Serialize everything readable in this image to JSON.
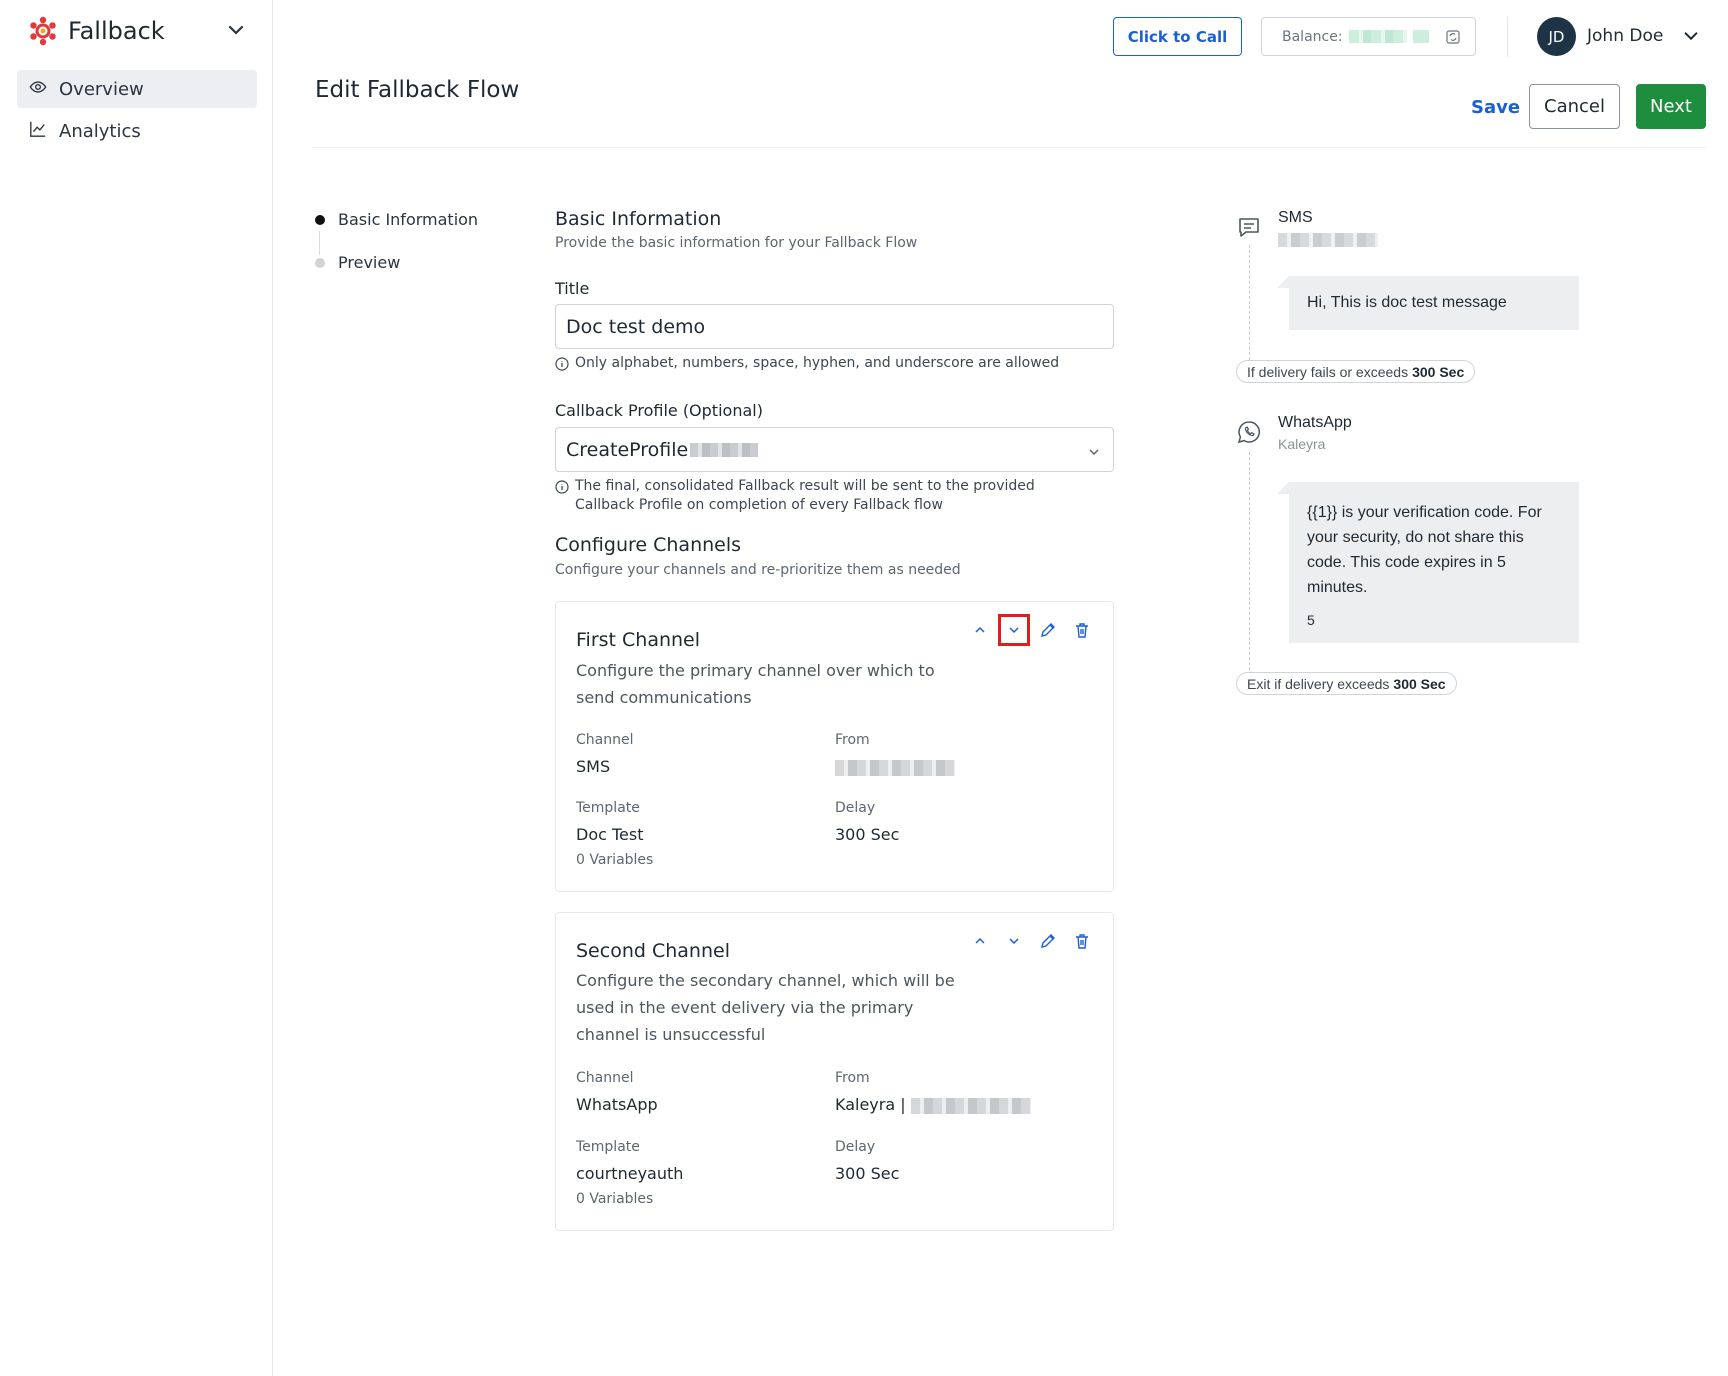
{
  "sidebar": {
    "brand": "Fallback",
    "items": [
      {
        "label": "Overview",
        "icon": "eye-icon",
        "active": true
      },
      {
        "label": "Analytics",
        "icon": "line-chart-icon",
        "active": false
      }
    ]
  },
  "topbar": {
    "click_to_call": "Click to Call",
    "balance_label": "Balance:",
    "user_initials": "JD",
    "user_name": "John Doe"
  },
  "header": {
    "title": "Edit Fallback Flow",
    "save": "Save",
    "cancel": "Cancel",
    "next": "Next"
  },
  "stepper": [
    {
      "label": "Basic Information",
      "active": true
    },
    {
      "label": "Preview",
      "active": false
    }
  ],
  "basic": {
    "heading": "Basic Information",
    "subheading": "Provide the basic information for your Fallback Flow",
    "title_label": "Title",
    "title_value": "Doc test demo",
    "title_hint": "Only alphabet, numbers, space, hyphen, and underscore are allowed",
    "callback_label": "Callback Profile (Optional)",
    "callback_value": "CreateProfile",
    "callback_hint_1": "The final, consolidated Fallback result will be sent to the provided",
    "callback_hint_2": "Callback Profile on completion of every Fallback flow"
  },
  "configure": {
    "heading": "Configure Channels",
    "subheading": "Configure your channels and re-prioritize them as needed"
  },
  "channels": [
    {
      "title": "First Channel",
      "desc_lines": [
        "Configure the primary channel over which to",
        "send communications"
      ],
      "channel_label": "Channel",
      "channel_value": "SMS",
      "from_label": "From",
      "from_value": "",
      "template_label": "Template",
      "template_value": "Doc Test",
      "variables": "0 Variables",
      "delay_label": "Delay",
      "delay_value": "300 Sec"
    },
    {
      "title": "Second Channel",
      "desc_lines": [
        "Configure the secondary channel, which will be",
        "used in the event delivery via the primary",
        "channel is unsuccessful"
      ],
      "channel_label": "Channel",
      "channel_value": "WhatsApp",
      "from_label": "From",
      "from_value": "Kaleyra |",
      "template_label": "Template",
      "template_value": "courtneyauth",
      "variables": "0 Variables",
      "delay_label": "Delay",
      "delay_value": "300 Sec"
    }
  ],
  "preview": {
    "sms_name": "SMS",
    "sms_message": "Hi, This is doc test message",
    "fail_text": "If delivery fails or exceeds",
    "fail_value": "300 Sec",
    "wa_name": "WhatsApp",
    "wa_sub": "Kaleyra",
    "wa_message_lines": [
      "{{1}} is your verification code. For",
      "your security, do not share this",
      "code. This code expires in 5",
      "minutes."
    ],
    "wa_footer": "5",
    "exit_text": "Exit if delivery exceeds",
    "exit_value": "300 Sec"
  },
  "colors": {
    "primary": "#1a5fd6",
    "success": "#1e8e3e",
    "brand": "#e0393e",
    "highlight": "#e01e1e"
  }
}
